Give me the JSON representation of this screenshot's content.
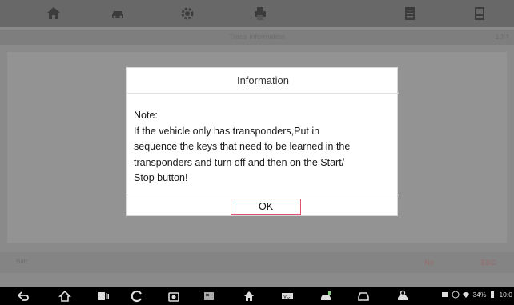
{
  "toolbar": {
    "items": [
      {
        "icon": "home-icon"
      },
      {
        "icon": "car-icon"
      },
      {
        "icon": "settings-gear-icon"
      },
      {
        "icon": "print-icon"
      },
      {
        "icon": "data-list-icon"
      },
      {
        "icon": "exit-icon"
      }
    ]
  },
  "background_app": {
    "title": "Trans information",
    "page": "10:4",
    "status_left": "Batt",
    "status_buttons": [
      "No",
      "ESC"
    ]
  },
  "dialog": {
    "title": "Information",
    "body_lines": [
      "Note:",
      "If the vehicle only has transponders,Put in",
      "sequence the keys that need to be learned in the",
      "transponders and turn off and then on the Start/",
      "Stop button!"
    ],
    "ok_label": "OK"
  },
  "navbar": {
    "items": [
      {
        "icon": "back-icon"
      },
      {
        "icon": "android-home-icon"
      },
      {
        "icon": "recent-apps-icon"
      },
      {
        "icon": "refresh-icon"
      },
      {
        "icon": "camera-icon"
      },
      {
        "icon": "screenshot-icon"
      },
      {
        "icon": "maxisys-home-icon"
      },
      {
        "icon": "vci-icon"
      },
      {
        "icon": "car-service-icon"
      },
      {
        "icon": "car-front-icon"
      },
      {
        "icon": "settings-car-icon"
      }
    ],
    "status": {
      "battery": "34%",
      "time": "10:0"
    }
  },
  "colors": {
    "ok_border": "#e0506a",
    "dim_overlay": "#8a8a8a",
    "toolbar_bg": "#686868",
    "navbar_bg": "#000000"
  }
}
